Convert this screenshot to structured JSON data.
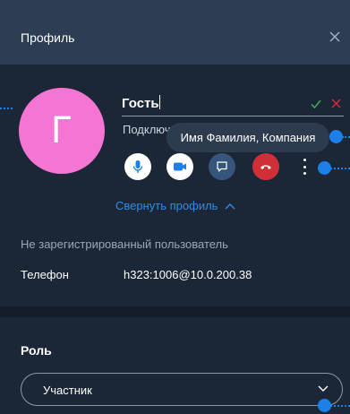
{
  "header": {
    "title": "Профиль",
    "close_icon": "close-icon"
  },
  "profile": {
    "avatar_letter": "Г",
    "avatar_color": "#f575d5",
    "name_value": "Гость",
    "status_text": "Подключен",
    "tooltip": "Имя Фамилия, Компания",
    "controls": {
      "mic": {
        "icon": "microphone-icon",
        "bg": "#ffffff"
      },
      "video": {
        "icon": "video-camera-icon",
        "bg": "#ffffff"
      },
      "chat": {
        "icon": "chat-icon",
        "bg": "#36557d"
      },
      "hangup": {
        "icon": "phone-hangup-icon",
        "bg": "#d12f38"
      },
      "more": {
        "icon": "more-vertical-icon"
      }
    },
    "collapse_label": "Свернуть профиль"
  },
  "details": {
    "unregistered": "Не зарегистрированный пользователь",
    "phone_label": "Телефон",
    "phone_value": "h323:1006@10.0.200.38"
  },
  "role": {
    "label": "Роль",
    "selected": "Участник"
  },
  "colors": {
    "background": "#1b2737",
    "header": "#2c3d54",
    "accent": "#2f8be7",
    "confirm": "#3db24a",
    "cancel": "#d12f38",
    "hint_marker": "#1d7fe8"
  }
}
